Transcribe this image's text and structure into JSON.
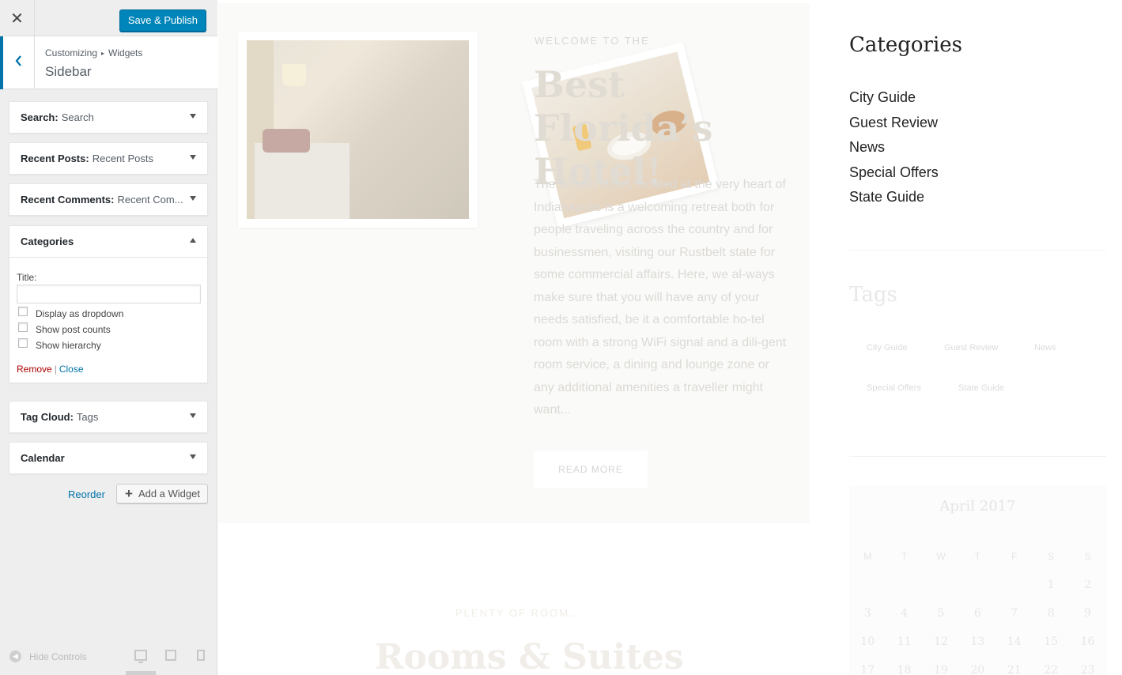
{
  "customizer": {
    "close_glyph": "✕",
    "save_label": "Save & Publish",
    "breadcrumb": [
      "Customizing",
      "Widgets"
    ],
    "breadcrumb_sep": "▸",
    "section_title": "Sidebar",
    "widgets": [
      {
        "type": "Search:",
        "title": "Search"
      },
      {
        "type": "Recent Posts:",
        "title": "Recent Posts"
      },
      {
        "type": "Recent Comments:",
        "title": "Recent Com..."
      },
      {
        "type": "Categories",
        "title": ""
      },
      {
        "type": "Tag Cloud:",
        "title": "Tags"
      },
      {
        "type": "Calendar",
        "title": ""
      }
    ],
    "categories_form": {
      "title_label": "Title:",
      "title_value": "",
      "checkboxes": [
        "Display as dropdown",
        "Show post counts",
        "Show hierarchy"
      ],
      "remove_label": "Remove",
      "separator": "|",
      "close_label": "Close"
    },
    "reorder_label": "Reorder",
    "add_widget_label": "Add a Widget",
    "add_widget_glyph": "+",
    "hide_controls_label": "Hide Controls"
  },
  "preview": {
    "hero": {
      "pre_title": "WELCOME TO THE",
      "title": "Best Florida’s Hotel!",
      "text": "The Woods hotel, located at the very heart of Indianapolis is a welcoming retreat both for people traveling across the country and for businessmen, visiting our Rustbelt state for some commercial affairs. Here, we al-ways make sure that you will have any of your needs satisfied, be it a comfortable ho-tel room with a strong WiFi signal and a dili-gent room service, a dining and lounge zone or any additional amenities a traveller might want...",
      "read_more": "READ MORE"
    },
    "rooms": {
      "pre_title": "PLENTY OF ROOM...",
      "title": "Rooms & Suites"
    },
    "categories_widget": {
      "heading": "Categories",
      "items": [
        "City Guide",
        "Guest Review",
        "News",
        "Special Offers",
        "State Guide"
      ]
    },
    "tags_widget": {
      "heading": "Tags",
      "tags": [
        "City Guide",
        "Guest Review",
        "News",
        "Special Offers",
        "State Guide"
      ]
    },
    "calendar_widget": {
      "month": "April 2017",
      "weekdays": [
        "M",
        "T",
        "W",
        "T",
        "F",
        "S",
        "S"
      ],
      "weeks": [
        [
          "",
          "",
          "",
          "",
          "",
          "1",
          "2"
        ],
        [
          "3",
          "4",
          "5",
          "6",
          "7",
          "8",
          "9"
        ],
        [
          "10",
          "11",
          "12",
          "13",
          "14",
          "15",
          "16"
        ],
        [
          "17",
          "18",
          "19",
          "20",
          "21",
          "22",
          "23"
        ]
      ]
    }
  }
}
